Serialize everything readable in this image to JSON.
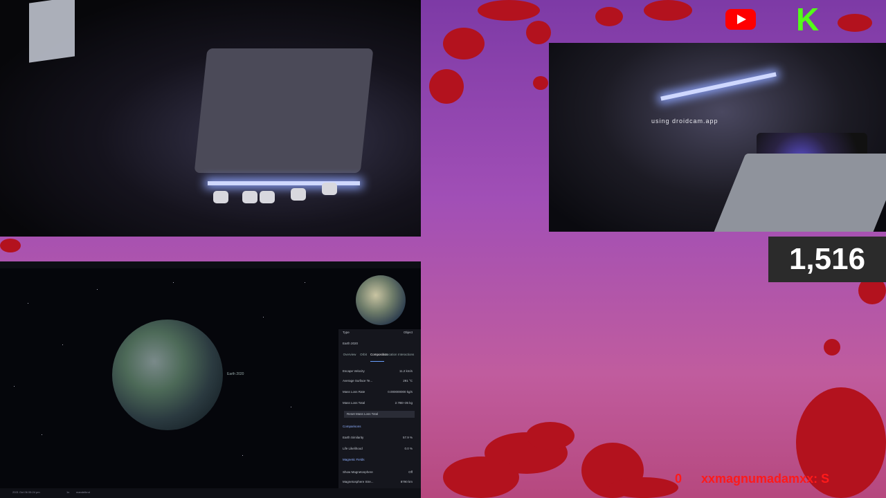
{
  "overlay": {
    "viewer_count": "1,516",
    "chat_count": "0",
    "chat_message": "xxmagnumadamxx: S",
    "droidcam_text": "using droidcam.app",
    "colors": {
      "blood": "#b3121e",
      "youtube": "#ff0000",
      "kick": "#53fc18"
    },
    "icons": [
      "youtube-icon",
      "kick-icon"
    ]
  },
  "space_app": {
    "object_label": "Earth 2020",
    "panel": {
      "type_label": "Type",
      "type_value": "Object",
      "title": "Earth 2020",
      "tabs": [
        "Overview",
        "Orbit",
        "Composition",
        "Location",
        "Interactions"
      ],
      "active_tab": "Composition",
      "rows": [
        {
          "label": "Escape Velocity",
          "value": "11.2 km/s"
        },
        {
          "label": "Average Surface Te...",
          "value": "291 °C"
        },
        {
          "label": "Mass Loss Rate",
          "value": "0.000000000 kg/s"
        },
        {
          "label": "Mass Loss Total",
          "value": "2.78E+35 kg"
        }
      ],
      "reset_button": "Reset Mass Loss Total",
      "comparisons_header": "Comparisons",
      "comparisons": [
        {
          "label": "Earth Similarity",
          "value": "57.9 %"
        },
        {
          "label": "Life Likelihood",
          "value": "0.0 %"
        }
      ],
      "magnetic_header": "Magnetic Fields",
      "magnetic": [
        {
          "label": "Show Magnetosphere",
          "value": "Off"
        },
        {
          "label": "Magnetosphere Stre...",
          "value": "8790 km"
        }
      ]
    },
    "bottom": {
      "date": "2021 Oct 06 05:24 pm",
      "speed": "1x",
      "status": "mandelbrot"
    }
  }
}
